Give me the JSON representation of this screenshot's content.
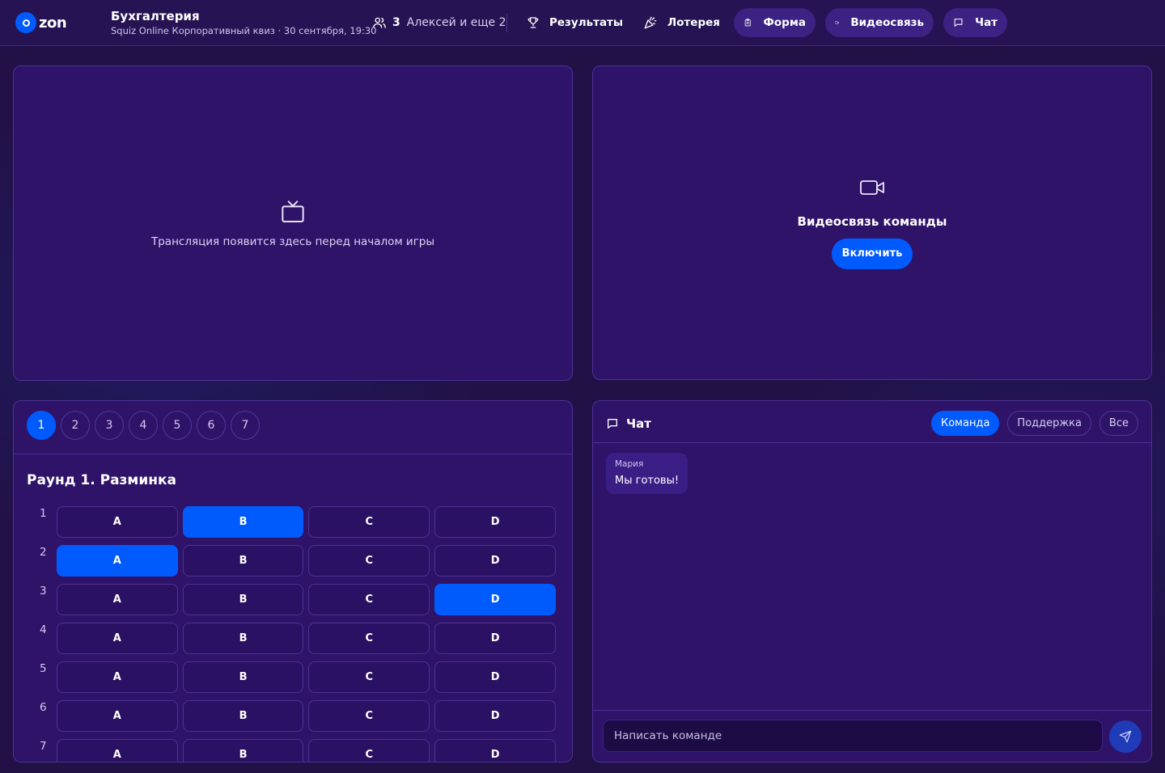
{
  "header": {
    "logo_text": "zon",
    "team_name": "Бухгалтерия",
    "event_info": "Squiz Online Корпоративный квиз · 30 сентября, 19:30",
    "members_count": "3",
    "members_names": "Алексей и еще 2",
    "nav": {
      "results": "Результаты",
      "lottery": "Лотерея",
      "form": "Форма",
      "video": "Видеосвязь",
      "chat": "Чат"
    }
  },
  "broadcast": {
    "message": "Трансляция появится здесь перед началом игры",
    "icon": "tv-icon"
  },
  "video_panel": {
    "title": "Видеосвязь команды",
    "enable_label": "Включить",
    "icon": "video-camera-icon"
  },
  "answers": {
    "rounds": [
      "1",
      "2",
      "3",
      "4",
      "5",
      "6",
      "7"
    ],
    "active_round": "1",
    "round_title": "Раунд 1. Разминка",
    "options": [
      "A",
      "B",
      "C",
      "D"
    ],
    "questions": [
      {
        "num": "1",
        "selected": "B"
      },
      {
        "num": "2",
        "selected": "A"
      },
      {
        "num": "3",
        "selected": "D"
      },
      {
        "num": "4",
        "selected": ""
      },
      {
        "num": "5",
        "selected": ""
      },
      {
        "num": "6",
        "selected": ""
      },
      {
        "num": "7",
        "selected": ""
      }
    ]
  },
  "chat": {
    "title": "Чат",
    "tabs": [
      "Команда",
      "Поддержка",
      "Все"
    ],
    "active_tab": "Команда",
    "messages": [
      {
        "author": "Мария",
        "text": "Мы готовы!"
      }
    ],
    "input_placeholder": "Написать команде",
    "input_value": ""
  },
  "colors": {
    "accent": "#005bff",
    "background": "#221147",
    "panel": "#2e1369"
  }
}
